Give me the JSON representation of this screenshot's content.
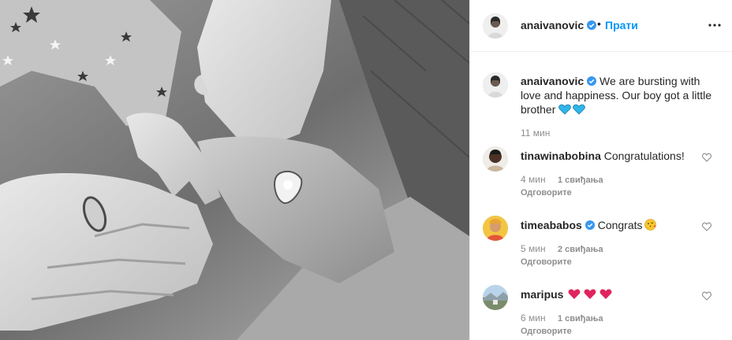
{
  "post": {
    "author": "anaivanovic",
    "follow_label": "Прати",
    "separator": "•",
    "caption_text": "We are bursting with love and happiness. Our boy got a little brother",
    "caption_time": "11 мин"
  },
  "comments": [
    {
      "username": "tinawinabobina",
      "text": "Congratulations!",
      "time": "4 мин",
      "likes": "1 свиђања",
      "reply": "Одговорите"
    },
    {
      "username": "timeababos",
      "text": "Congrats",
      "time": "5 мин",
      "likes": "2 свиђања",
      "reply": "Одговорите"
    },
    {
      "username": "maripus",
      "text": "",
      "time": "6 мин",
      "likes": "1 свиђања",
      "reply": "Одговорите"
    }
  ],
  "colors": {
    "link_blue": "#0095f6",
    "verified_blue": "#3897f0",
    "secondary_text": "#8e8e8e",
    "heart_red": "#e0245e",
    "heart_blue": "#2fb5e8"
  },
  "icons": {
    "verified": "verified-badge-icon",
    "more": "more-options-icon",
    "like": "heart-outline-icon"
  }
}
